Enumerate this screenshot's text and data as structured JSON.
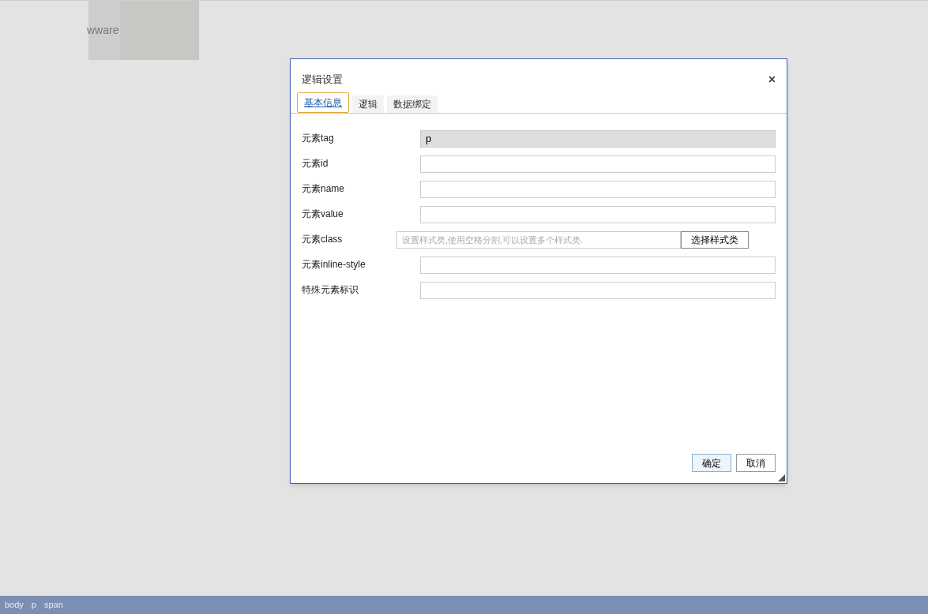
{
  "background": {
    "banner_text": "wware"
  },
  "dialog": {
    "title": "逻辑设置",
    "close": "×",
    "tabs": [
      {
        "label": "基本信息",
        "selected": true
      },
      {
        "label": "逻辑",
        "selected": false
      },
      {
        "label": "数据绑定",
        "selected": false
      }
    ],
    "fields": [
      {
        "kind": "readonly",
        "label": "元素tag",
        "value": "p"
      },
      {
        "kind": "text",
        "label": "元素id"
      },
      {
        "kind": "text",
        "label": "元素name"
      },
      {
        "kind": "text",
        "label": "元素value"
      },
      {
        "kind": "class",
        "label": "元素class",
        "placeholder": "设置样式类,使用空格分割,可以设置多个样式类.",
        "button": "选择样式类"
      },
      {
        "kind": "text",
        "label": "元素inline-style"
      },
      {
        "kind": "text",
        "label": "特殊元素标识"
      }
    ],
    "buttons": [
      {
        "label": "确定",
        "primary": true
      },
      {
        "label": "取消",
        "primary": false
      }
    ]
  },
  "status_bar": [
    "body",
    "p",
    "span"
  ]
}
